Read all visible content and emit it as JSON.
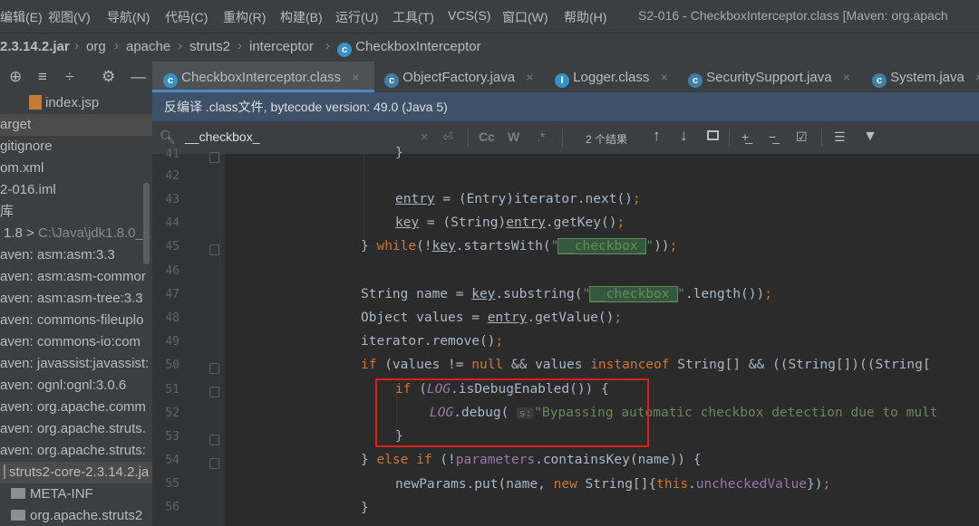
{
  "menubar": {
    "items": [
      "编辑(E)",
      "视图(V)",
      "导航(N)",
      "代码(C)",
      "重构(R)",
      "构建(B)",
      "运行(U)",
      "工具(T)",
      "VCS(S)",
      "窗口(W)",
      "帮助(H)"
    ],
    "window_title": "S2-016 - CheckboxInterceptor.class [Maven: org.apach"
  },
  "breadcrumb": {
    "items": [
      "2.3.14.2.jar",
      "org",
      "apache",
      "struts2",
      "interceptor",
      "CheckboxInterceptor"
    ]
  },
  "sidebar": {
    "rows": [
      "index.jsp",
      "arget",
      "gitignore",
      "om.xml",
      "2-016.iml",
      "库",
      "1.8 >",
      "aven: asm:asm:3.3",
      "aven: asm:asm-commor",
      "aven: asm:asm-tree:3.3",
      "aven: commons-fileuplo",
      "aven: commons-io:com",
      "aven: javassist:javassist:",
      "aven: ognl:ognl:3.0.6",
      "aven: org.apache.comm",
      "aven: org.apache.struts.",
      "aven: org.apache.struts:",
      "struts2-core-2.3.14.2.ja",
      "META-INF",
      "org.apache.struts2"
    ],
    "jdk_path": "C:\\Java\\jdk1.8.0_1"
  },
  "tabs": [
    "CheckboxInterceptor.class",
    "ObjectFactory.java",
    "Logger.class",
    "SecuritySupport.java",
    "System.java"
  ],
  "infobar": {
    "text": "反编译 .class文件, bytecode version: 49.0 (Java 5)"
  },
  "search": {
    "value": "__checkbox_",
    "cc": "Cc",
    "w": "W",
    "regex": ".*",
    "result_count": "2 个结果"
  },
  "editor": {
    "line_numbers": [
      "41",
      "42",
      "43",
      "44",
      "45",
      "46",
      "47",
      "48",
      "49",
      "50",
      "51",
      "52",
      "53",
      "54",
      "55",
      "56"
    ],
    "hint": "s:",
    "debug_message": "\"Bypassing automatic checkbox detection due to mult"
  }
}
